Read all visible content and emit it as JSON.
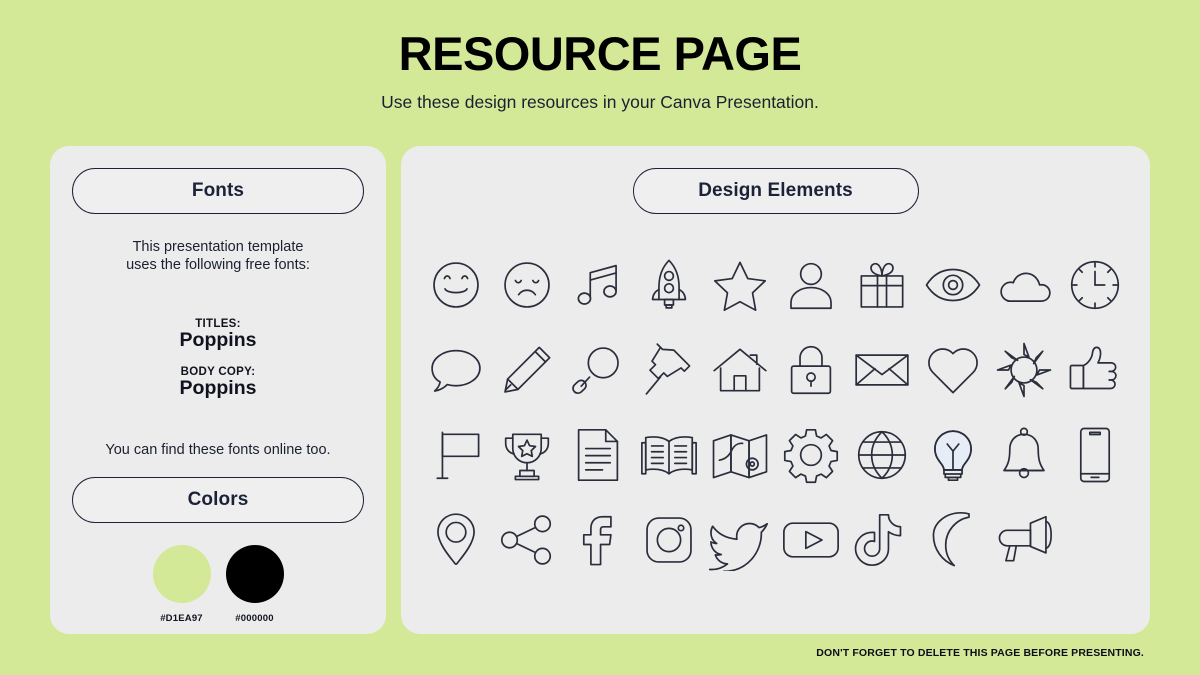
{
  "header": {
    "title": "RESOURCE PAGE",
    "subtitle": "Use these design resources in your Canva Presentation."
  },
  "fonts_panel": {
    "pill_label": "Fonts",
    "intro_line_1": "This presentation template",
    "intro_line_2": "uses the following free fonts:",
    "titles_role": "TITLES:",
    "titles_font": "Poppins",
    "body_role": "BODY COPY:",
    "body_font": "Poppins",
    "outro": "You can find these fonts online too."
  },
  "colors_panel": {
    "pill_label": "Colors",
    "swatches": [
      {
        "hex": "#D1EA97",
        "label": "#D1EA97"
      },
      {
        "hex": "#000000",
        "label": "#000000"
      }
    ]
  },
  "elements_panel": {
    "pill_label": "Design Elements",
    "icons": [
      "smiley-face-icon",
      "sad-face-icon",
      "music-note-icon",
      "rocket-icon",
      "star-icon",
      "person-icon",
      "gift-icon",
      "eye-icon",
      "cloud-icon",
      "clock-icon",
      "speech-bubble-icon",
      "pencil-icon",
      "magnifying-glass-icon",
      "pushpin-icon",
      "house-icon",
      "lock-icon",
      "envelope-icon",
      "heart-icon",
      "sun-icon",
      "thumbs-up-icon",
      "flag-icon",
      "trophy-icon",
      "document-icon",
      "open-book-icon",
      "map-icon",
      "gear-icon",
      "globe-icon",
      "lightbulb-icon",
      "bell-icon",
      "smartphone-icon",
      "location-pin-icon",
      "share-icon",
      "facebook-icon",
      "instagram-icon",
      "twitter-icon",
      "youtube-icon",
      "tiktok-icon",
      "moon-icon",
      "megaphone-icon"
    ]
  },
  "footer": {
    "note": "DON'T FORGET TO DELETE THIS PAGE BEFORE PRESENTING."
  },
  "theme": {
    "background": "#D1EA97",
    "panel": "#ECECEC",
    "ink": "#1C2338",
    "icon_stroke": "#2A2E3C",
    "bulb_tint": "#E6EDF6"
  }
}
